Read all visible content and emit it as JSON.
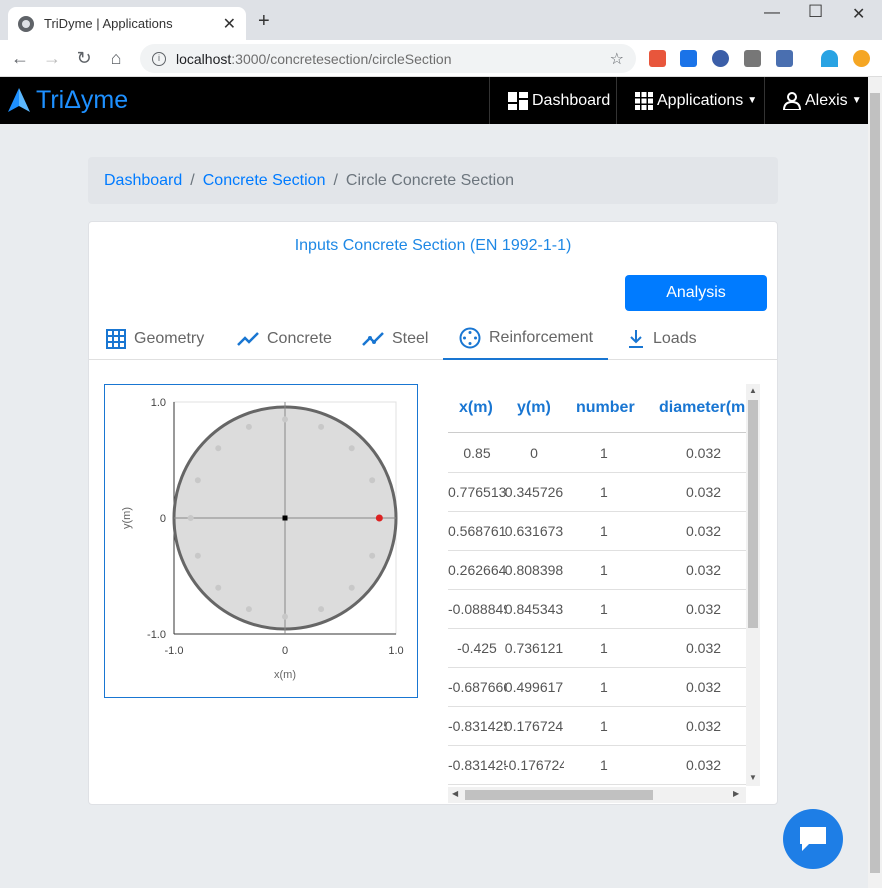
{
  "browser": {
    "tab_title": "TriDyme | Applications",
    "url_host": "localhost",
    "url_path": ":3000/concretesection/circleSection",
    "window_controls": [
      "minimize",
      "maximize",
      "close"
    ]
  },
  "navbar": {
    "brand": "TriΔyme",
    "dashboard": "Dashboard",
    "applications": "Applications",
    "user": "Alexis"
  },
  "breadcrumb": {
    "items": [
      "Dashboard",
      "Concrete Section"
    ],
    "active": "Circle Concrete Section"
  },
  "card": {
    "title": "Inputs Concrete Section (EN 1992-1-1)",
    "analysis_button": "Analysis",
    "tabs": [
      {
        "label": "Geometry",
        "icon": "grid-icon"
      },
      {
        "label": "Concrete",
        "icon": "trend-icon"
      },
      {
        "label": "Steel",
        "icon": "trend-dots-icon"
      },
      {
        "label": "Reinforcement",
        "icon": "circle-dots-icon"
      },
      {
        "label": "Loads",
        "icon": "download-arrow-icon"
      }
    ],
    "active_tab": "Reinforcement"
  },
  "chart_data": {
    "type": "scatter",
    "xlabel": "x(m)",
    "ylabel": "y(m)",
    "xlim": [
      -1.0,
      1.0
    ],
    "ylim": [
      -1.0,
      1.0
    ],
    "x_ticks": [
      "-1.0",
      "0",
      "1.0"
    ],
    "y_ticks": [
      "1.0",
      "0",
      "-1.0"
    ],
    "section_radius": 1.0,
    "bars_radius": 0.85,
    "bars_count": 16,
    "highlighted_bar": [
      0.85,
      0
    ],
    "origin_marker": [
      0,
      0
    ],
    "colors": {
      "section_fill": "#dcdcdc",
      "section_stroke": "#666666",
      "bar": "#c8c8c8",
      "highlight": "#dd2222"
    }
  },
  "table": {
    "headers": [
      "x(m)",
      "y(m)",
      "number",
      "diameter(m"
    ],
    "rows": [
      [
        "0.85",
        "0",
        "1",
        "0.032"
      ],
      [
        "0.776513",
        "0.345726",
        "1",
        "0.032"
      ],
      [
        "0.568761",
        "0.631673",
        "1",
        "0.032"
      ],
      [
        "0.262664",
        "0.808398",
        "1",
        "0.032"
      ],
      [
        "-0.088849",
        "0.845343",
        "1",
        "0.032"
      ],
      [
        "-0.425",
        "0.736121",
        "1",
        "0.032"
      ],
      [
        "-0.687666",
        "0.499617",
        "1",
        "0.032"
      ],
      [
        "-0.831425",
        "0.176724",
        "1",
        "0.032"
      ],
      [
        "-0.831425",
        "-0.176724",
        "1",
        "0.032"
      ]
    ]
  }
}
